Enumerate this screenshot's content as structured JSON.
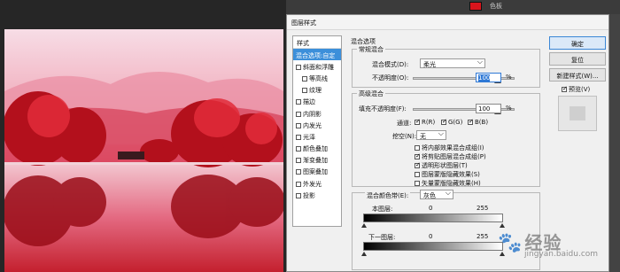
{
  "dialog": {
    "title": "图层样式"
  },
  "styles": {
    "header": "样式",
    "items": [
      {
        "label": "混合选项:自定",
        "checked": null,
        "active": true,
        "indent": false
      },
      {
        "label": "斜面和浮雕",
        "checked": false,
        "active": false,
        "indent": false
      },
      {
        "label": "等高线",
        "checked": false,
        "active": false,
        "indent": true
      },
      {
        "label": "纹理",
        "checked": false,
        "active": false,
        "indent": true
      },
      {
        "label": "描边",
        "checked": false,
        "active": false,
        "indent": false
      },
      {
        "label": "内阴影",
        "checked": false,
        "active": false,
        "indent": false
      },
      {
        "label": "内发光",
        "checked": false,
        "active": false,
        "indent": false
      },
      {
        "label": "光泽",
        "checked": false,
        "active": false,
        "indent": false
      },
      {
        "label": "颜色叠加",
        "checked": false,
        "active": false,
        "indent": false
      },
      {
        "label": "渐变叠加",
        "checked": false,
        "active": false,
        "indent": false
      },
      {
        "label": "图案叠加",
        "checked": false,
        "active": false,
        "indent": false
      },
      {
        "label": "外发光",
        "checked": false,
        "active": false,
        "indent": false
      },
      {
        "label": "投影",
        "checked": false,
        "active": false,
        "indent": false
      }
    ]
  },
  "blending": {
    "section_title": "混合选项",
    "general_title": "常规混合",
    "mode_label": "混合模式(D):",
    "mode_value": "柔光",
    "opacity_label": "不透明度(O):",
    "opacity_value": "100",
    "percent": "%"
  },
  "advanced": {
    "title": "高级混合",
    "fill_label": "填充不透明度(F):",
    "fill_value": "100",
    "percent": "%",
    "channels_label": "通道:",
    "channels": [
      {
        "label": "R(R)",
        "checked": true
      },
      {
        "label": "G(G)",
        "checked": true
      },
      {
        "label": "B(B)",
        "checked": true
      }
    ],
    "knockout_label": "挖空(N):",
    "knockout_value": "无",
    "options": [
      {
        "label": "将内部效果混合成组(I)",
        "checked": false
      },
      {
        "label": "将剪贴图层混合成组(P)",
        "checked": true
      },
      {
        "label": "透明形状图层(T)",
        "checked": true
      },
      {
        "label": "图层蒙版隐藏效果(S)",
        "checked": false
      },
      {
        "label": "矢量蒙版隐藏效果(H)",
        "checked": false
      }
    ]
  },
  "blend_if": {
    "label": "混合颜色带(E):",
    "value": "灰色",
    "this_layer": "本图层:",
    "this_min": "0",
    "this_max": "255",
    "under_layer": "下一图层:",
    "under_min": "0",
    "under_max": "255"
  },
  "buttons": {
    "ok": "确定",
    "reset": "复位",
    "new_style": "新建样式(W)...",
    "preview": "预览(V)",
    "preview_checked": true
  },
  "app": {
    "swatch_color": "#d9151c",
    "panel_label": "色板"
  },
  "watermark": {
    "text": "经验",
    "sub": "jingyan.baidu.com"
  }
}
